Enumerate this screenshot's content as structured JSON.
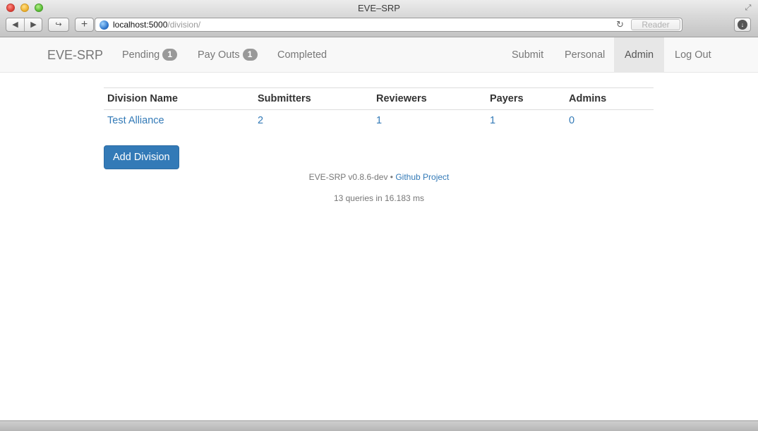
{
  "window": {
    "title": "EVE–SRP"
  },
  "browser": {
    "url_host": "localhost:5000",
    "url_path": "/division/",
    "reader_label": "Reader",
    "icons": [
      "back-icon",
      "forward-icon",
      "share-icon",
      "add-tab-icon",
      "globe-icon",
      "reload-icon",
      "download-icon",
      "fullscreen-icon"
    ]
  },
  "navbar": {
    "brand": "EVE-SRP",
    "left": [
      {
        "label": "Pending",
        "badge": "1"
      },
      {
        "label": "Pay Outs",
        "badge": "1"
      },
      {
        "label": "Completed"
      }
    ],
    "right": [
      {
        "label": "Submit"
      },
      {
        "label": "Personal"
      },
      {
        "label": "Admin",
        "active": true
      },
      {
        "label": "Log Out"
      }
    ]
  },
  "table": {
    "headers": [
      "Division Name",
      "Submitters",
      "Reviewers",
      "Payers",
      "Admins"
    ],
    "rows": [
      [
        "Test Alliance",
        "2",
        "1",
        "1",
        "0"
      ]
    ]
  },
  "add_division_label": "Add Division",
  "footer": {
    "version": "EVE-SRP v0.8.6-dev • ",
    "link": "Github Project",
    "queries": "13 queries in 16.183 ms"
  },
  "colors": {
    "link": "#337ab7",
    "button": "#337ab7",
    "badge": "#999999",
    "active_nav": "#e7e7e7"
  }
}
